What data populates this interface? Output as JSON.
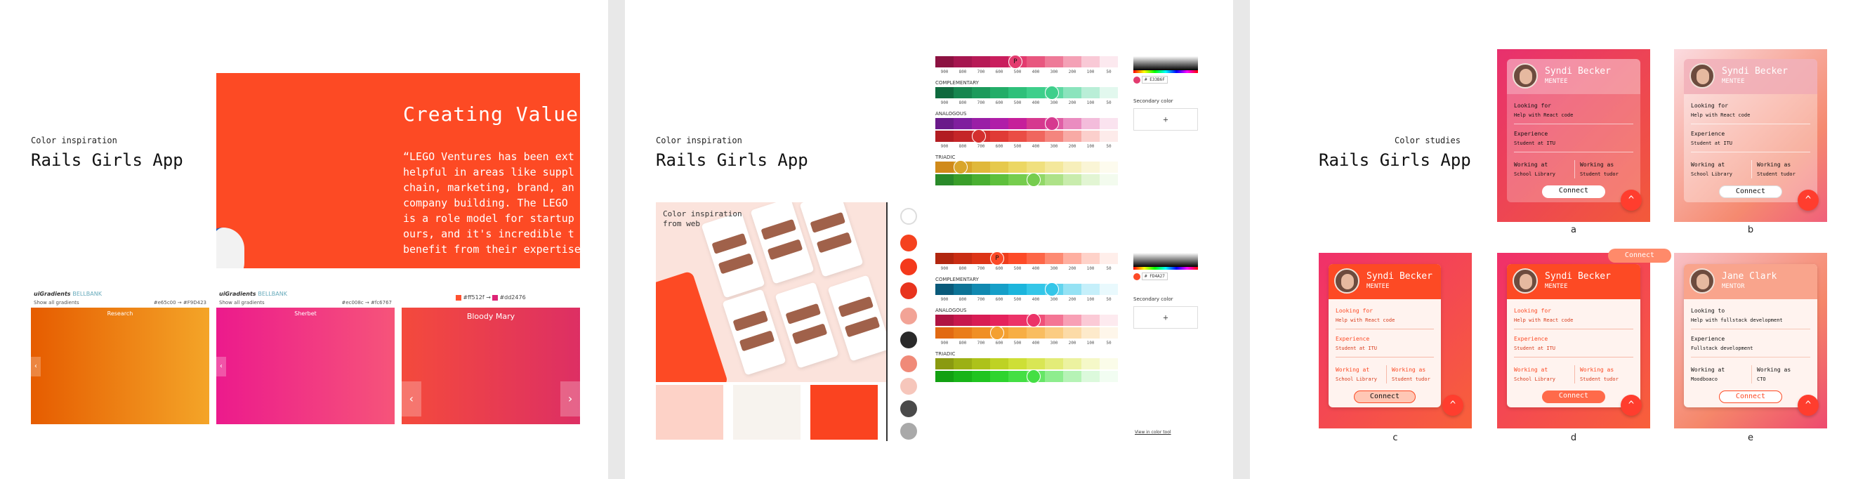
{
  "panel1": {
    "eyebrow": "Color inspiration",
    "title": "Rails Girls App",
    "hero": {
      "title": "Creating Value",
      "quote": "“LEGO Ventures has been ext\nhelpful in areas like suppl\nchain, marketing, brand, an\ncompany building. The LEGO\nis a role model for startup\nours, and it's incredible t\nbenefit from their expertise"
    },
    "gradients": [
      {
        "logo": "uiGradients",
        "tag": "BELLBANK",
        "label": "Research",
        "left_small": "Show all gradients",
        "right_small": "#e65c00 → #F9D423"
      },
      {
        "logo": "uiGradients",
        "tag": "BELLBANK",
        "label": "Sherbet",
        "left_small": "Show all gradients",
        "right_small": "#ec008c → #fc6767"
      }
    ],
    "bloody": {
      "hex1": "#ff512f",
      "arrow": "→",
      "hex2": "#dd2476",
      "label": "Bloody Mary",
      "prev": "‹",
      "next": "›"
    }
  },
  "panel2": {
    "eyebrow": "Color inspiration",
    "title": "Rails Girls App",
    "web_label": "Color inspiration\nfrom web",
    "palette_labels": [
      "COMPLEMENTARY",
      "ANALOGOUS",
      "TRIADIC"
    ],
    "scale_nums": [
      "900",
      "800",
      "700",
      "600",
      "500",
      "400",
      "300",
      "200",
      "100",
      "50"
    ],
    "hex1": "# E33B6F",
    "hex2": "# FD4A27",
    "secondary_label": "Secondary color",
    "plus": "+",
    "view_link": "View in color tool",
    "marker": "P"
  },
  "panel3": {
    "eyebrow": "Color studies",
    "title": "Rails Girls App",
    "floating_connect": "Connect",
    "cards": [
      {
        "cap": "a",
        "name": "Syndi Becker",
        "role": "MENTEE",
        "l1": "Looking for",
        "v1": "Help with React code",
        "l2": "Experience",
        "v2": "Student at ITU",
        "l3": "Working at",
        "v3": "School Library",
        "l4": "Working as",
        "v4": "Student tudor",
        "btn": "Connect"
      },
      {
        "cap": "b",
        "name": "Syndi Becker",
        "role": "MENTEE",
        "l1": "Looking for",
        "v1": "Help with React code",
        "l2": "Experience",
        "v2": "Student at ITU",
        "l3": "Working at",
        "v3": "School Library",
        "l4": "Working as",
        "v4": "Student tudor",
        "btn": "Connect"
      },
      {
        "cap": "c",
        "name": "Syndi Becker",
        "role": "MENTEE",
        "l1": "Looking for",
        "v1": "Help with React code",
        "l2": "Experience",
        "v2": "Student at ITU",
        "l3": "Working at",
        "v3": "School Library",
        "l4": "Working as",
        "v4": "Student tudor",
        "btn": "Connect"
      },
      {
        "cap": "d",
        "name": "Syndi Becker",
        "role": "MENTEE",
        "l1": "Looking for",
        "v1": "Help with React code",
        "l2": "Experience",
        "v2": "Student at ITU",
        "l3": "Working at",
        "v3": "School Library",
        "l4": "Working as",
        "v4": "Student tudor",
        "btn": "Connect"
      },
      {
        "cap": "e",
        "name": "Jane Clark",
        "role": "MENTOR",
        "l1": "Looking to",
        "v1": "Help with fullstack development",
        "l2": "Experience",
        "v2": "Fullstack development",
        "l3": "Working at",
        "v3": "Moodboaco",
        "l4": "Working as",
        "v4": "CTO",
        "btn": "Connect"
      }
    ],
    "up_icon": "^"
  }
}
